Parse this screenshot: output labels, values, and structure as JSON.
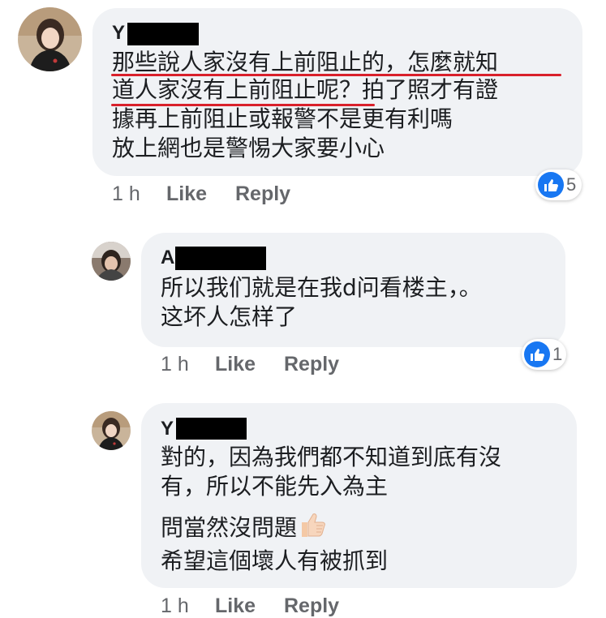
{
  "comments": [
    {
      "author_initial": "Y",
      "lines": [
        "那些說人家沒有上前阻止的，怎麼就知",
        "道人家沒有上前阻止呢？拍了照才有證",
        "據再上前阻止或報警不是更有利嗎",
        "放上網也是警惕大家要小心"
      ],
      "time": "1 h",
      "like_label": "Like",
      "reply_label": "Reply",
      "reaction_count": "5"
    },
    {
      "author_initial": "A",
      "lines": [
        "所以我们就是在我d问看楼主，。",
        "这坏人怎样了"
      ],
      "time": "1 h",
      "like_label": "Like",
      "reply_label": "Reply",
      "reaction_count": "1"
    },
    {
      "author_initial": "Y",
      "lines": [
        "對的，因為我們都不知道到底有沒",
        "有，所以不能先入為主",
        "問當然沒問題",
        "希望這個壞人有被抓到"
      ],
      "time": "1 h",
      "like_label": "Like",
      "reply_label": "Reply"
    }
  ],
  "icons": {
    "reaction": "thumbs-up-icon",
    "emoji": "thumbs-up-emoji-icon"
  },
  "colors": {
    "bubble": "#f0f2f5",
    "like_blue": "#1877f2",
    "underline_red": "#d9202b",
    "meta_gray": "#65676b"
  }
}
